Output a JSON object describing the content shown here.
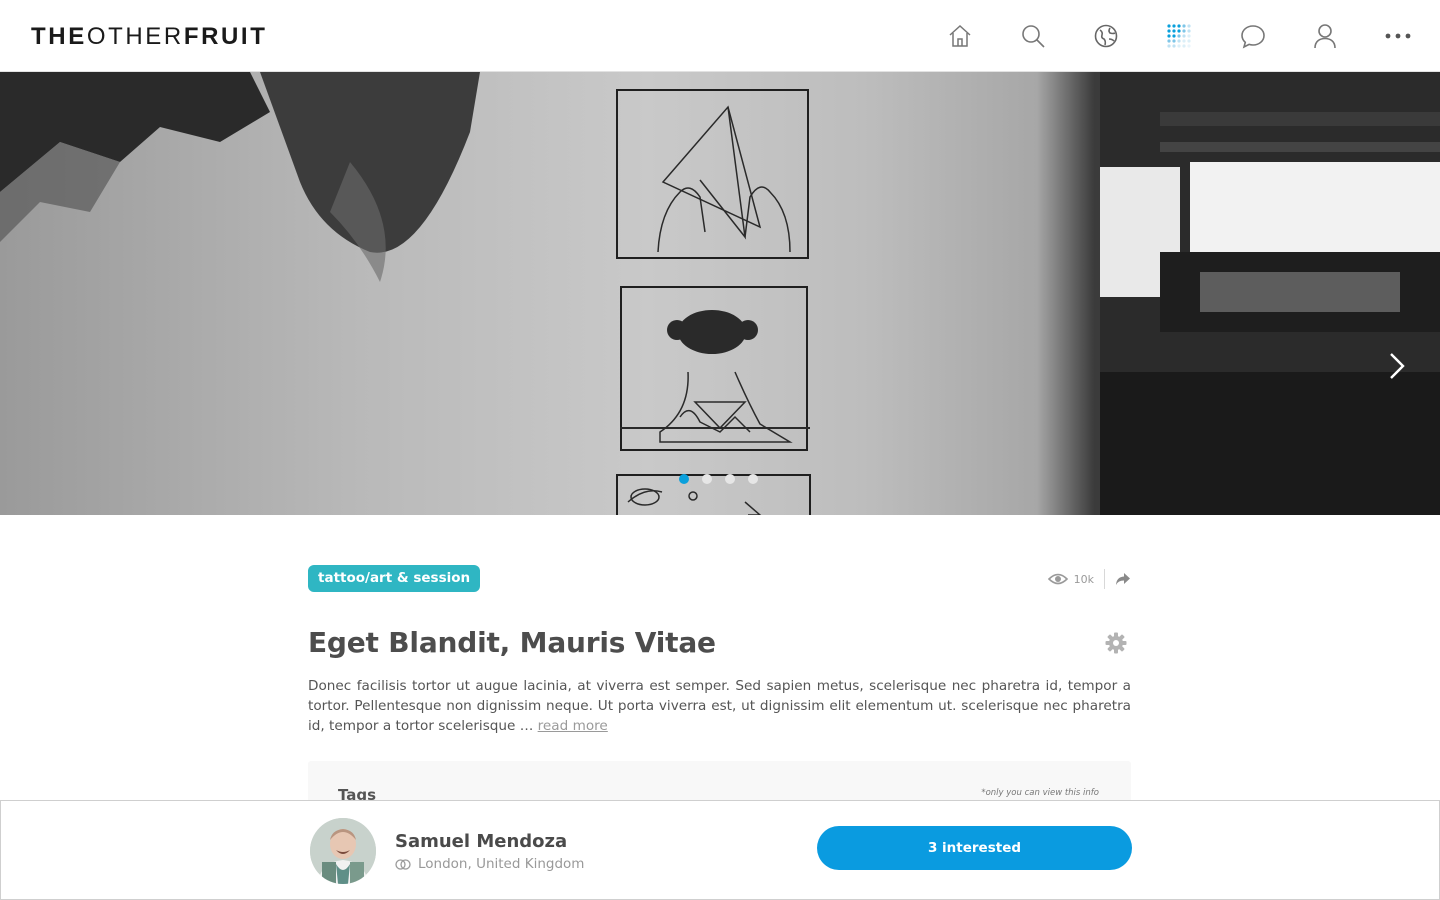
{
  "app": {
    "logo_bold_1": "THE",
    "logo_thin": "OTHER",
    "logo_bold_2": "FRUIT"
  },
  "nav": {
    "icons": [
      "home-icon",
      "search-icon",
      "globe-icon",
      "grid-dots-icon",
      "chat-icon",
      "user-icon",
      "more-icon"
    ],
    "active_icon": "grid-dots-icon",
    "active_color": "#0aa0dc"
  },
  "hero": {
    "image_subject": "black-and-white photo of a line-art tattoo on a back",
    "slide_count": 4,
    "active_slide": 1
  },
  "post": {
    "category": "tattoo/art & session",
    "views": "10k",
    "title": "Eget Blandit, Mauris Vitae",
    "description": "Donec facilisis tortor ut augue lacinia, at viverra est semper. Sed sapien metus, scelerisque nec pharetra id, tempor a tortor. Pellentesque non dignissim neque. Ut porta viverra est, ut dignissim elit elementum ut.  scelerisque nec pharetra id, tempor a tortor  scelerisque … ",
    "read_more": "read more",
    "tags_title": "Tags",
    "tags_note": "*only you can view this info"
  },
  "author": {
    "name": "Samuel Mendoza",
    "location": "London, United Kingdom"
  },
  "cta": {
    "label": "3 interested"
  },
  "colors": {
    "accent": "#0a9be0",
    "category_bg": "#2fb6c3"
  }
}
